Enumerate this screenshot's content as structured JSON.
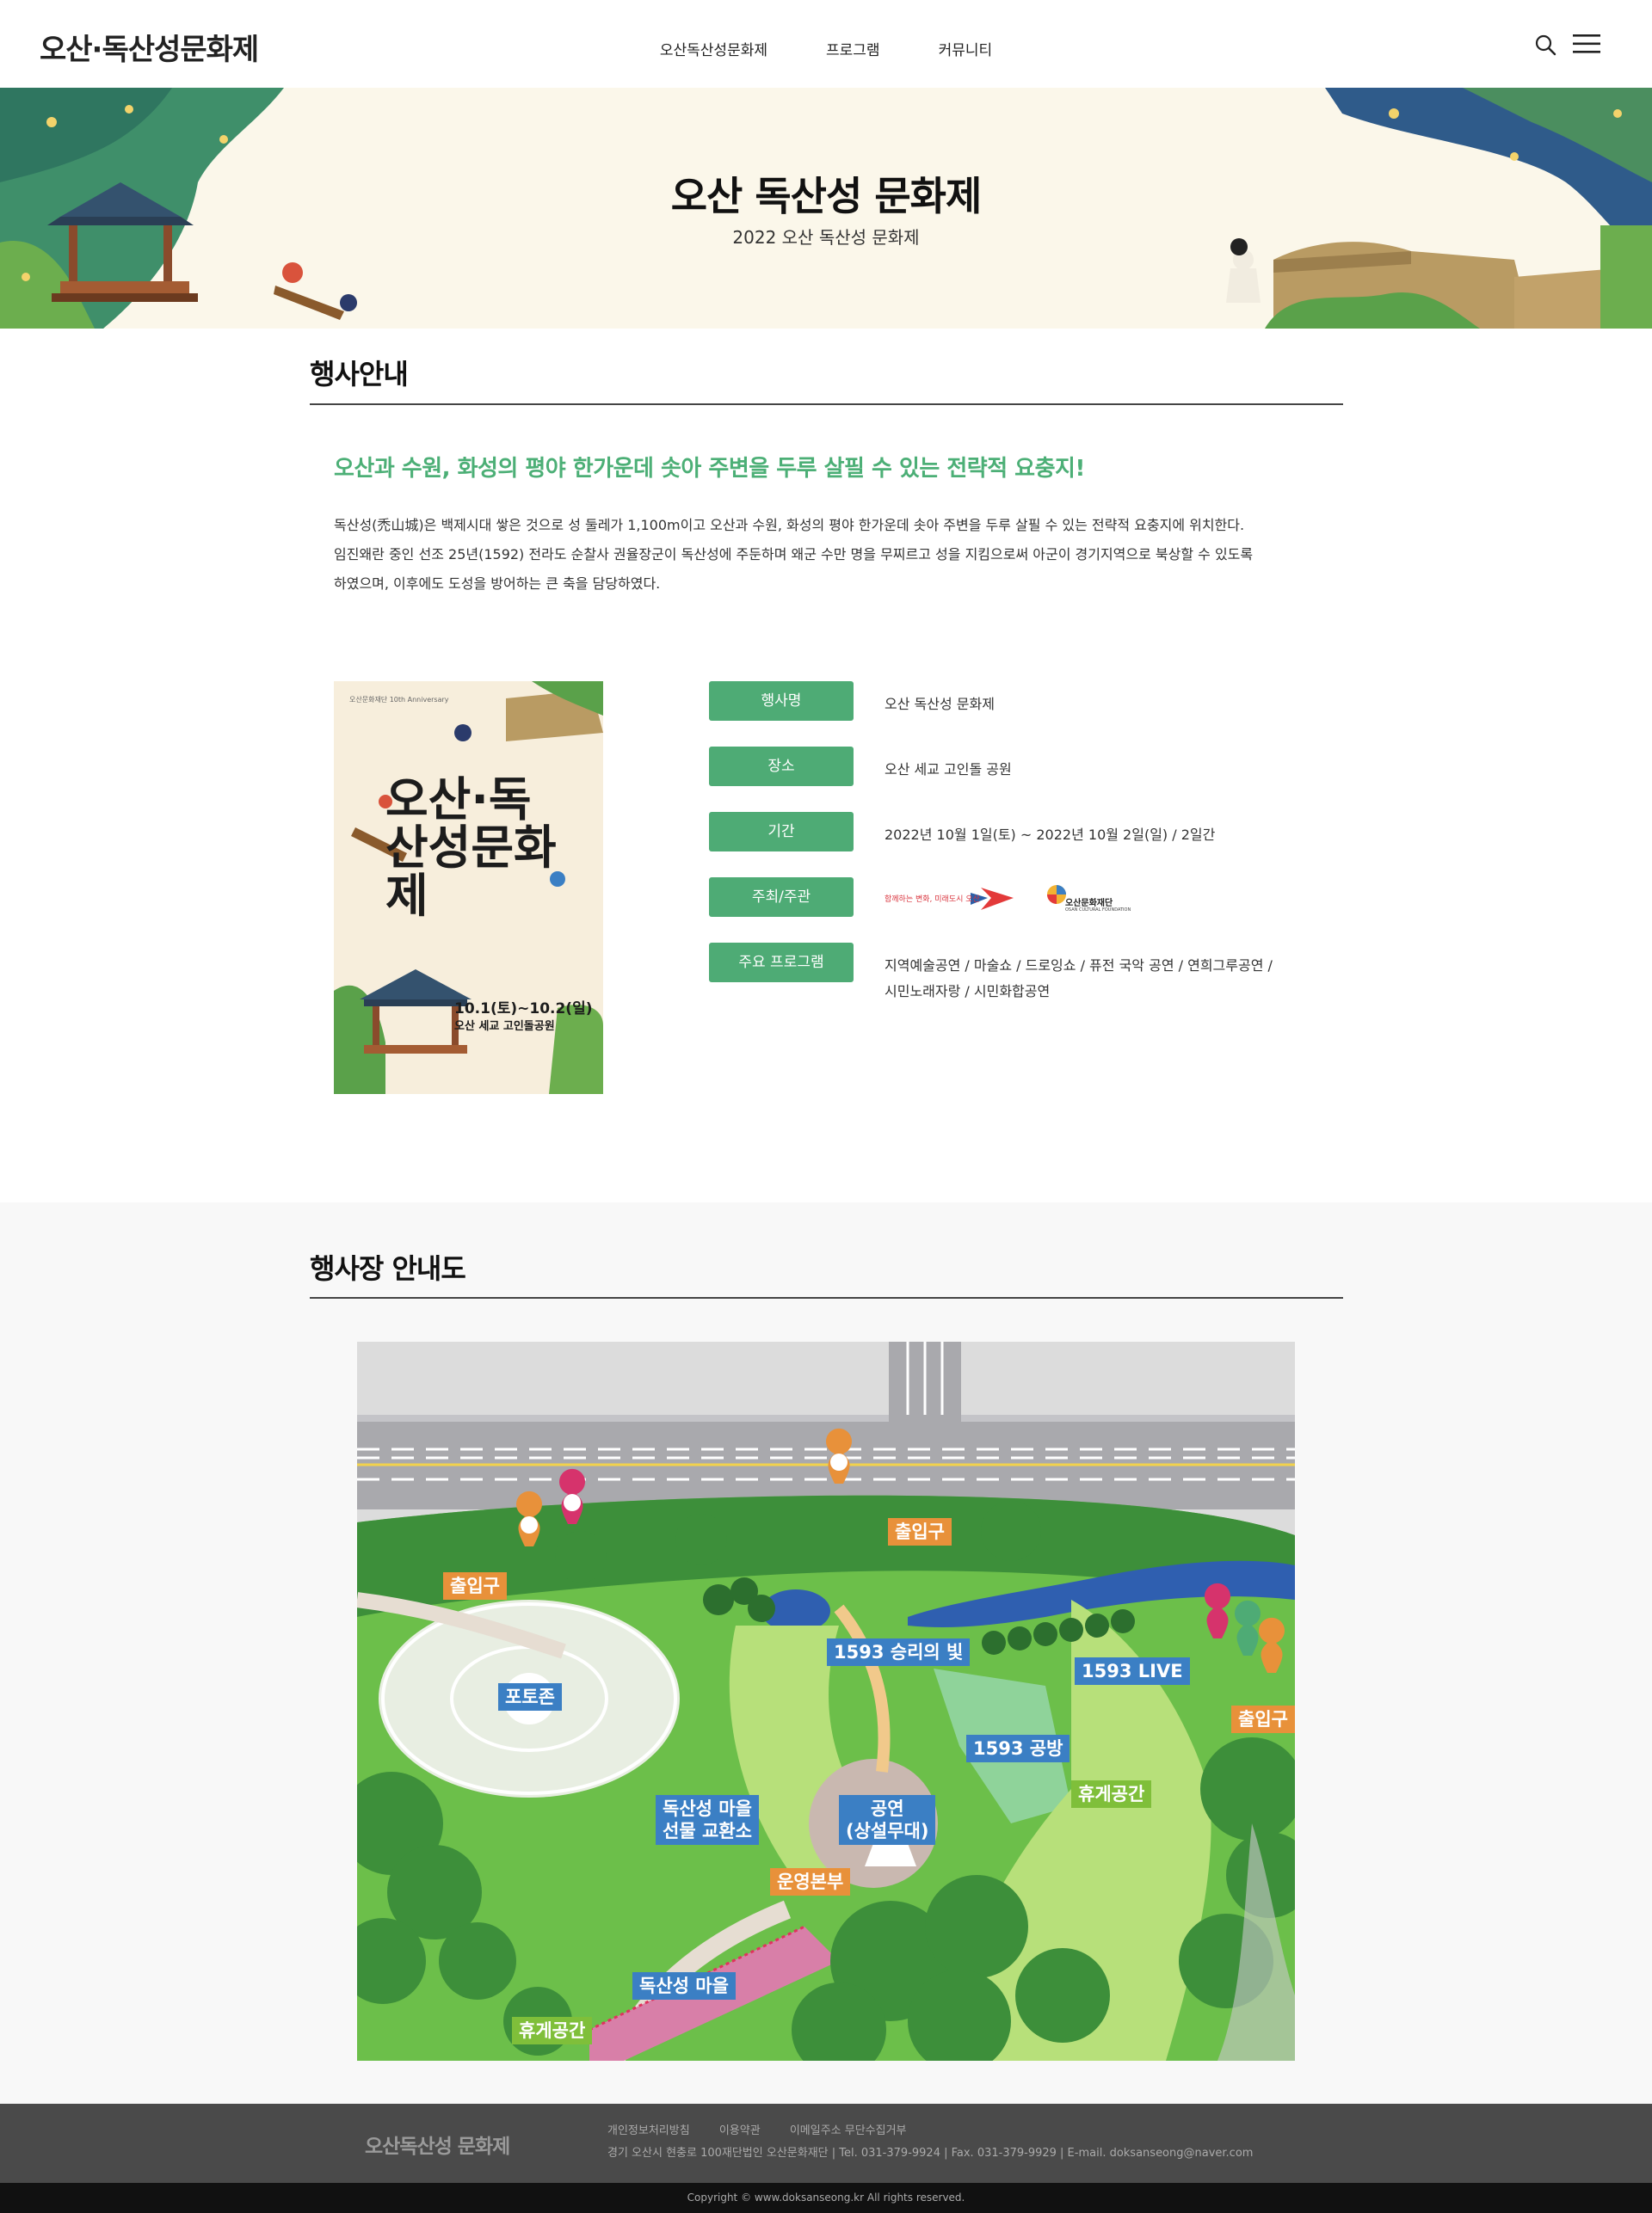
{
  "header": {
    "logo": "오산·독산성문화제",
    "nav": [
      "오산독산성문화제",
      "프로그램",
      "커뮤니티"
    ]
  },
  "hero": {
    "title": "오산 독산성 문화제",
    "subtitle": "2022 오산 독산성 문화제"
  },
  "section1": {
    "title": "행사안내",
    "headline": "오산과 수원, 화성의 평야 한가운데 솟아 주변을 두루 살필 수 있는 전략적 요충지!",
    "desc": [
      "독산성(禿山城)은 백제시대 쌓은 것으로 성 둘레가 1,100m이고 오산과 수원, 화성의 평야 한가운데 솟아 주변을 두루 살필 수 있는 전략적 요충지에 위치한다.",
      "임진왜란 중인 선조 25년(1592) 전라도 순찰사 권율장군이 독산성에 주둔하며 왜군 수만 명을 무찌르고 성을 지킴으로써 아군이 경기지역으로 북상할 수 있도록",
      "하였으며, 이후에도 도성을 방어하는 큰 축을 담당하였다."
    ],
    "poster": {
      "badge": "오산문화재단 10th Anniversary",
      "title": "오산·독산성문화제",
      "date": "10.1(토)~10.2(일)",
      "place": "오산 세교 고인돌공원"
    },
    "info": [
      {
        "label": "행사명",
        "value": "오산 독산성 문화제"
      },
      {
        "label": "장소",
        "value": "오산 세교 고인돌 공원"
      },
      {
        "label": "기간",
        "value": "2022년 10월 1일(토) ~ 2022년 10월 2일(일) / 2일간"
      },
      {
        "label": "주최/주관",
        "value": ""
      },
      {
        "label": "주요 프로그램",
        "value": "지역예술공연 / 마술쇼 / 드로잉쇼 / 퓨전 국악 공연 / 연희그루공연 /",
        "value2": "시민노래자랑 / 시민화합공연"
      }
    ],
    "sponsors": {
      "a": "함께하는 변화, 미래도시 오산",
      "b": "오산문화재단",
      "b_sub": "OSAN CULTURAL FOUNDATION"
    }
  },
  "section2": {
    "title": "행사장 안내도",
    "labels": {
      "exit_top": "출입구",
      "exit_left": "출입구",
      "exit_right": "출입구",
      "victory": "1593 승리의 빛",
      "live": "1593 LIVE",
      "photozone": "포토존",
      "plaza": "1593 공방",
      "rest_right": "휴게공간",
      "gift_1": "독산성 마을",
      "gift_2": "선물 교환소",
      "stage_1": "공연",
      "stage_2": "(상설무대)",
      "hq": "운영본부",
      "village": "독산성 마을",
      "rest_bottom": "휴게공간"
    }
  },
  "footer": {
    "logo": "오산독산성 문화제",
    "links": [
      "개인정보처리방침",
      "이용약관",
      "이메일주소 무단수집거부"
    ],
    "address": "경기 오산시 현충로 100재단법인 오산문화재단   |   Tel. 031-379-9924   |   Fax. 031-379-9929   |   E-mail. doksanseong@naver.com",
    "copyright": "Copyright © www.doksanseong.kr All rights reserved."
  },
  "colors": {
    "accent_green": "#4eab75",
    "headline_green": "#4caf76",
    "label_orange": "#e8913a",
    "label_blue": "#3b7fc4",
    "label_green": "#7fbf3a"
  }
}
